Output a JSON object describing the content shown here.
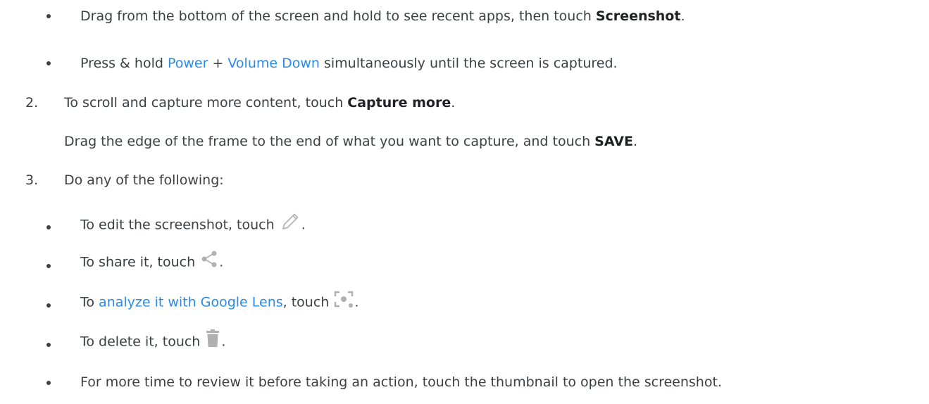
{
  "steps_1_bullets": [
    {
      "pre": "Drag from the bottom of the screen and hold to see recent apps, then touch ",
      "bold": "Screenshot",
      "post": "."
    },
    {
      "link1": "Power",
      "mid": " + ",
      "link2": "Volume Down",
      "post": " simultaneously until the screen is captured.",
      "pre": "Press & hold "
    }
  ],
  "step2": {
    "number": "2.",
    "pre": "To scroll and capture more content, touch ",
    "bold": "Capture more",
    "post": ".",
    "detail_pre": "Drag the edge of the frame to the end of what you want to capture, and touch ",
    "detail_bold": "SAVE",
    "detail_post": "."
  },
  "step3": {
    "number": "3.",
    "text": "Do any of the following:",
    "bullets": [
      {
        "pre": "To edit the screenshot, touch ",
        "icon": "pencil-icon",
        "post": "."
      },
      {
        "pre": "To share it, touch ",
        "icon": "share-icon",
        "post": "."
      },
      {
        "pre": "To ",
        "link": "analyze it with Google Lens",
        "mid": ", touch ",
        "icon": "lens-icon",
        "post": "."
      },
      {
        "pre": "To delete it, touch ",
        "icon": "trash-icon",
        "post": "."
      },
      {
        "pre": "For more time to review it before taking an action, touch the thumbnail to open the screenshot."
      }
    ]
  },
  "colors": {
    "text": "#3c4043",
    "link": "#2b8ae8",
    "icon": "#b0b0b0"
  }
}
